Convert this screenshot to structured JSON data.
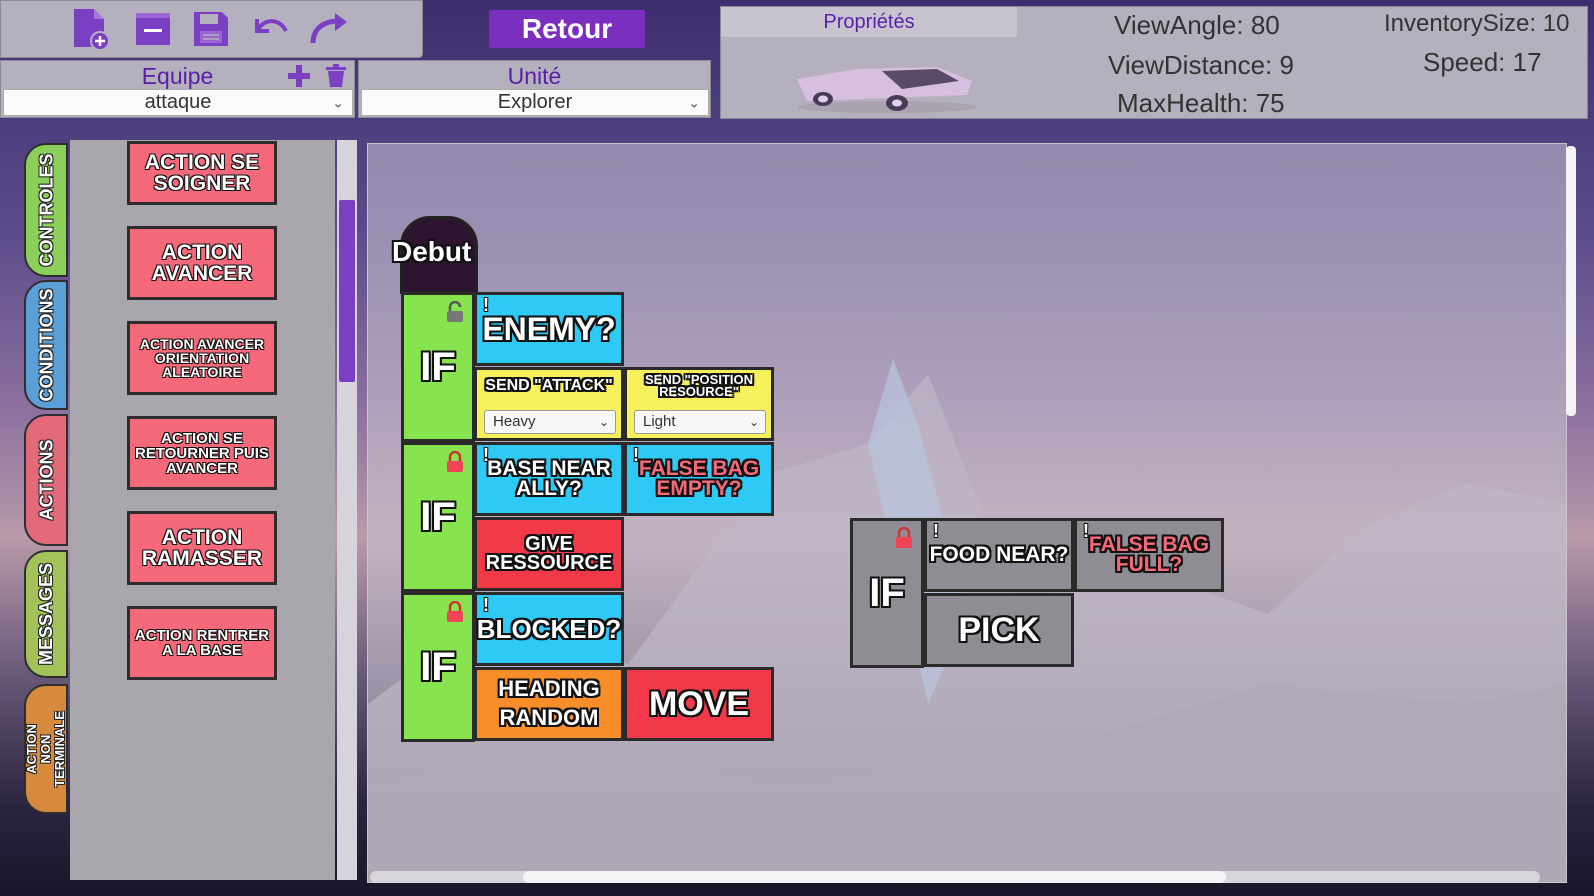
{
  "toolbar": {
    "icons": [
      "new-file-icon",
      "delete-file-icon",
      "save-icon",
      "undo-icon",
      "redo-icon"
    ]
  },
  "retour_label": "Retour",
  "team": {
    "title": "Equipe",
    "selected": "attaque"
  },
  "unit": {
    "title": "Unité",
    "selected": "Explorer"
  },
  "properties": {
    "title": "Propriétés",
    "view_angle": "ViewAngle: 80",
    "view_distance": "ViewDistance: 9",
    "max_health": "MaxHealth: 75",
    "inventory_size": "InventorySize: 10",
    "speed": "Speed: 17"
  },
  "tabs": [
    "CONTROLES",
    "CONDITIONS",
    "ACTIONS",
    "MESSAGES",
    "ACTION NON TERMINALE"
  ],
  "library": [
    "Action se soigner",
    "Action avancer",
    "Action avancer orientation aleatoire",
    "Action se retourner puis avancer",
    "Action ramasser",
    "Action rentrer a la base"
  ],
  "canvas": {
    "debut": "Debut",
    "if_label": "IF",
    "enemy": "ENEMY?",
    "send_attack": "SEND \"ATTACK\"",
    "send_attack_value": "Heavy",
    "send_position": "SEND \"POSITION RESOURCE\"",
    "send_position_value": "Light",
    "base_near_ally": "BASE NEAR ALLY?",
    "false_bag_empty": "FALSE BAG EMPTY?",
    "give_ressource": "GIVE RESSOURCE",
    "blocked": "BLOCKED?",
    "heading_random": "HEADING RANDOM",
    "move": "MOVE",
    "food_near": "FOOD NEAR?",
    "false_bag_full": "FALSE BAG FULL?",
    "pick": "PICK",
    "bang": "!"
  }
}
